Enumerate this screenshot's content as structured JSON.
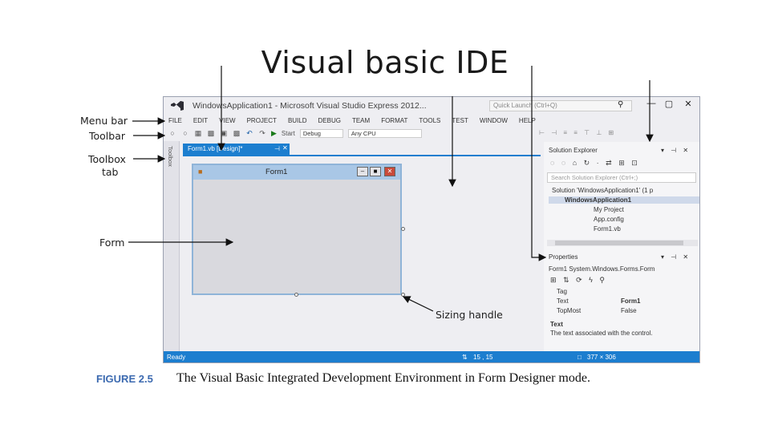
{
  "slide_title": "Visual basic IDE",
  "ide": {
    "window_title": "WindowsApplication1 - Microsoft Visual Studio Express 2012...",
    "quick_launch": "Quick Launch (Ctrl+Q)",
    "menu": [
      "FILE",
      "EDIT",
      "VIEW",
      "PROJECT",
      "BUILD",
      "DEBUG",
      "TEAM",
      "FORMAT",
      "TOOLS",
      "TEST",
      "WINDOW",
      "HELP"
    ],
    "toolbar": {
      "start": "Start",
      "config": "Debug",
      "platform": "Any CPU"
    },
    "toolbox_tab": "Toolbox",
    "doc_tab": "Form1.vb [Design]*",
    "form": {
      "caption": "Form1"
    },
    "solution_explorer": {
      "title": "Solution Explorer",
      "search_placeholder": "Search Solution Explorer (Ctrl+;)",
      "items": [
        "Solution 'WindowsApplication1' (1 p",
        "WindowsApplication1",
        "My Project",
        "App.config",
        "Form1.vb"
      ]
    },
    "properties": {
      "title": "Properties",
      "object": "Form1 System.Windows.Forms.Form",
      "rows": [
        {
          "name": "Tag",
          "value": ""
        },
        {
          "name": "Text",
          "value": "Form1"
        },
        {
          "name": "TopMost",
          "value": "False"
        }
      ],
      "desc_title": "Text",
      "desc_text": "The text associated with the control."
    },
    "status": {
      "text": "Ready",
      "position": "15 , 15",
      "size": "377 × 306"
    }
  },
  "callouts": {
    "menu_bar": "Menu bar",
    "toolbar": "Toolbar",
    "toolbox_tab_line1": "Toolbox",
    "toolbox_tab_line2": "tab",
    "form": "Form",
    "sizing_handle": "Sizing handle"
  },
  "figure_caption": {
    "label": "FIGURE 2.5",
    "text": "The Visual Basic Integrated Development Environment in Form Designer mode."
  }
}
